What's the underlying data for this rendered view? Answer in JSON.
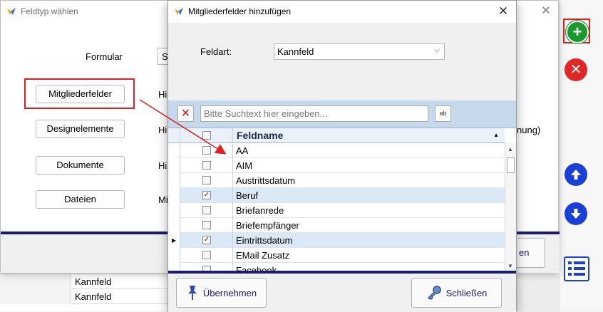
{
  "background": {
    "rows": [
      {
        "value": "Kannfeld"
      },
      {
        "value": "Kannfeld"
      }
    ]
  },
  "feldtyp_dialog": {
    "title": "Feldtyp wählen",
    "formular_label": "Formular",
    "formular_value": "S",
    "buttons": [
      {
        "label": "Mitgliederfelder",
        "side": "Hi"
      },
      {
        "label": "Designelemente",
        "side": "Hi"
      },
      {
        "label": "Dokumente",
        "side": "Hi"
      },
      {
        "label": "Dateien",
        "side": "Mi"
      }
    ],
    "right_text": "nung)",
    "footer_button_partial": "en"
  },
  "mitglieder_dialog": {
    "title": "Mitgliederfelder hinzufügen",
    "feldart_label": "Feldart:",
    "feldart_value": "Kannfeld",
    "search_placeholder": "Bitte Suchtext hier eingeben...",
    "search_option_icon": "ab",
    "column_header": "Feldname",
    "sort_indicator": "▲",
    "rows": [
      {
        "name": "AA",
        "checked": false,
        "selected": false,
        "current": false
      },
      {
        "name": "AIM",
        "checked": false,
        "selected": false,
        "current": false
      },
      {
        "name": "Austrittsdatum",
        "checked": false,
        "selected": false,
        "current": false
      },
      {
        "name": "Beruf",
        "checked": true,
        "selected": true,
        "current": false
      },
      {
        "name": "Briefanrede",
        "checked": false,
        "selected": false,
        "current": false
      },
      {
        "name": "Briefempfänger",
        "checked": false,
        "selected": false,
        "current": false
      },
      {
        "name": "Eintrittsdatum",
        "checked": true,
        "selected": true,
        "current": true
      },
      {
        "name": "EMail Zusatz",
        "checked": false,
        "selected": false,
        "current": false
      },
      {
        "name": "Facebook",
        "checked": false,
        "selected": false,
        "current": false
      }
    ],
    "uebernehmen_label": "Übernehmen",
    "schliessen_label": "Schließen"
  },
  "toolbar": {
    "icons": [
      "add-icon",
      "delete-icon",
      "arrow-up-icon",
      "arrow-down-icon",
      "list-icon"
    ],
    "colors": {
      "add": "#1a9a2c",
      "delete": "#e02626",
      "move": "#1a3fd6",
      "frame": "#e02020"
    }
  }
}
